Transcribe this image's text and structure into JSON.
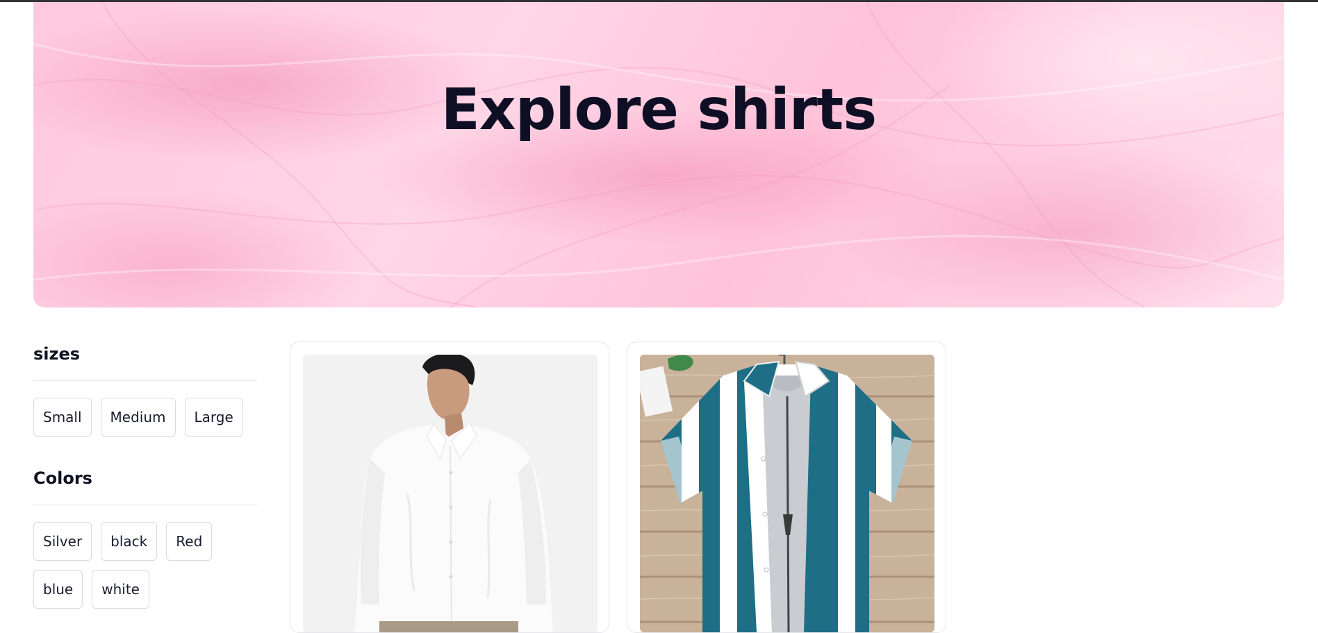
{
  "hero": {
    "title": "Explore shirts"
  },
  "filters": {
    "sizes": {
      "heading": "sizes",
      "options": [
        "Small",
        "Medium",
        "Large"
      ]
    },
    "colors": {
      "heading": "Colors",
      "options": [
        "Silver",
        "black",
        "Red",
        "blue",
        "white"
      ]
    }
  },
  "products": [
    {
      "image": "white-linen-shirt-model-photo"
    },
    {
      "image": "teal-white-striped-shirt-photo"
    }
  ],
  "colors": {
    "hero_background": "#ffcfe1",
    "text_primary": "#0e0e25",
    "chip_border": "#dadade"
  }
}
